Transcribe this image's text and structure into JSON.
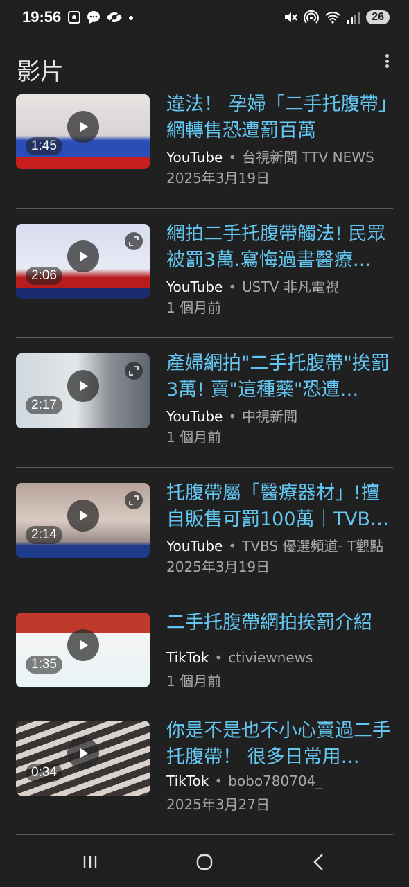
{
  "status_bar": {
    "time": "19:56",
    "battery": "26",
    "left_icons": [
      "screenshot-icon",
      "chat-icon",
      "eye-slash-icon",
      "dot-icon"
    ],
    "right_icons": [
      "mute-icon",
      "hotspot-icon",
      "wifi-icon",
      "signal-icon"
    ]
  },
  "section": {
    "title": "影片"
  },
  "videos": [
    {
      "title": "違法！ 孕婦「二手托腹帶」網轉售恐遭罰百萬",
      "duration": "1:45",
      "source": "YouTube",
      "channel": "台視新聞 TTV NEWS",
      "date": "2025年3月19日"
    },
    {
      "title": "網拍二手托腹帶觸法! 民眾被罰3萬.寫悔過書醫療…",
      "duration": "2:06",
      "source": "YouTube",
      "channel": "USTV 非凡電視",
      "date": "1 個月前"
    },
    {
      "title": "產婦網拍\"二手托腹帶\"挨罰3萬! 賣\"這種藥\"恐遭…",
      "duration": "2:17",
      "source": "YouTube",
      "channel": "中視新聞",
      "date": "1 個月前"
    },
    {
      "title": "托腹帶屬「醫療器材」!擅自販售可罰100萬｜TVB…",
      "duration": "2:14",
      "source": "YouTube",
      "channel": "TVBS 優選頻道- T觀點",
      "date": "2025年3月19日"
    },
    {
      "title": "二手托腹帶網拍挨罰介紹",
      "duration": "1:35",
      "source": "TikTok",
      "channel": "ctiviewnews",
      "date": "1 個月前"
    },
    {
      "title": "你是不是也不小心賣過二手托腹帶！ 很多日常用…",
      "duration": "0:34",
      "source": "TikTok",
      "channel": "bobo780704_",
      "date": "2025年3月27日"
    }
  ],
  "colors": {
    "background": "#1f1f1f",
    "link_title": "#63c7f2",
    "meta_text": "#a8a8a8"
  }
}
